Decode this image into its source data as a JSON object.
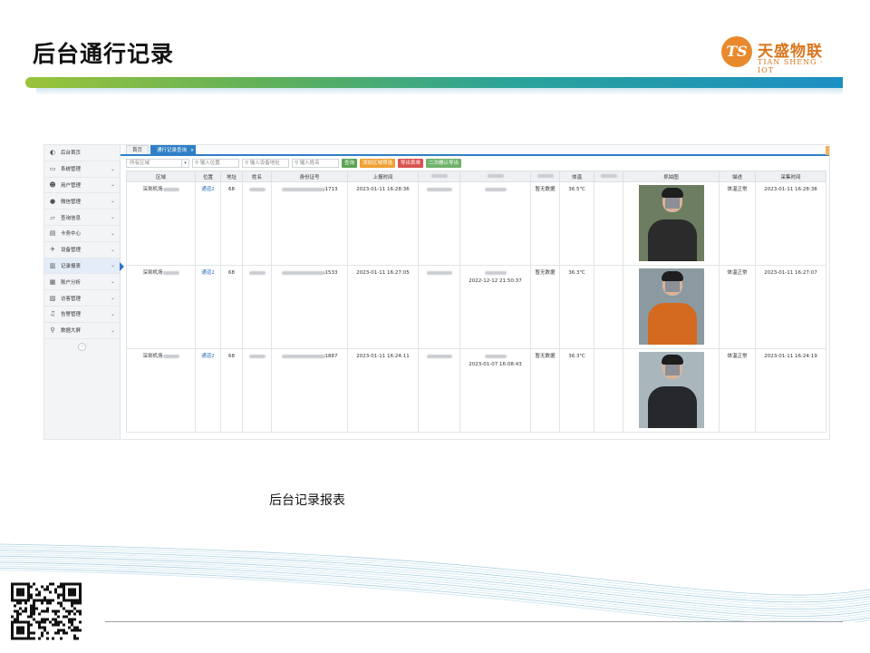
{
  "slide": {
    "title": "后台通行记录",
    "logo": {
      "mark": "TS",
      "mark_sub": "IOT",
      "name_cn": "天盛物联",
      "name_en": "TIAN SHENG · IOT"
    },
    "caption": "后台记录报表"
  },
  "app": {
    "sidebar": {
      "items": [
        {
          "label": "后台首页",
          "icon": "dashboard-icon",
          "active": false
        },
        {
          "label": "系统管理",
          "icon": "monitor-icon",
          "active": false
        },
        {
          "label": "用户管理",
          "icon": "users-icon",
          "active": false
        },
        {
          "label": "微信管理",
          "icon": "wechat-icon",
          "active": false
        },
        {
          "label": "查询信息",
          "icon": "laptop-icon",
          "active": false
        },
        {
          "label": "卡务中心",
          "icon": "card-icon",
          "active": false
        },
        {
          "label": "设备管理",
          "icon": "plane-icon",
          "active": false
        },
        {
          "label": "记录报表",
          "icon": "bar-chart-icon",
          "active": true
        },
        {
          "label": "账户分析",
          "icon": "calendar-icon",
          "active": false
        },
        {
          "label": "访客管理",
          "icon": "visitor-icon",
          "active": false
        },
        {
          "label": "告警管理",
          "icon": "bell-icon",
          "active": false
        },
        {
          "label": "数据大屏",
          "icon": "pin-icon",
          "active": false
        }
      ],
      "collapse_glyph": "‹"
    },
    "tabs": [
      {
        "label": "首页",
        "active": false
      },
      {
        "label": "通行记录查询",
        "active": true
      }
    ],
    "toolbar": {
      "area_select": "所有区域",
      "inputs": [
        "输入位置",
        "输入设备地址",
        "输入姓名"
      ],
      "buttons": [
        {
          "label": "查询",
          "color": "#5aa454"
        },
        {
          "label": "添加区域筛选",
          "color": "#f0a030"
        },
        {
          "label": "导出表单",
          "color": "#d9534f"
        },
        {
          "label": "二次确认导出",
          "color": "#6fb26a"
        }
      ]
    },
    "table": {
      "headers": [
        "区域",
        "位置",
        "地址",
        "姓名",
        "身份证号",
        "上报时间",
        "",
        "",
        "",
        "体温",
        "",
        "抓拍图",
        "描述",
        "采集时间"
      ],
      "rows": [
        {
          "area": "深圳机场",
          "location": "通道2",
          "address": "68",
          "id_tail": "1713",
          "report_time": "2023-01-11 16:28:36",
          "time2": "",
          "no_data": "暂无数据",
          "temperature": "36.5℃",
          "description": "体温正常",
          "collect_time": "2023-01-11 16:28:38",
          "photo_palette": {
            "bg": "#6d7d61",
            "body": "#2b2b2b"
          }
        },
        {
          "area": "深圳机场",
          "location": "通道2",
          "address": "68",
          "id_tail": "1533",
          "report_time": "2023-01-11 16:27:05",
          "time2": "2022-12-12 21:50:37",
          "no_data": "暂无数据",
          "temperature": "36.3℃",
          "description": "体温正常",
          "collect_time": "2023-01-11 16:27:07",
          "photo_palette": {
            "bg": "#8a9aa0",
            "body": "#d46a1f"
          }
        },
        {
          "area": "深圳机场",
          "location": "通道2",
          "address": "68",
          "id_tail": "1887",
          "report_time": "2023-01-11 16:24:11",
          "time2": "2023-01-07 16:08:43",
          "no_data": "暂无数据",
          "temperature": "36.3℃",
          "description": "体温正常",
          "collect_time": "2023-01-11 16:24:19",
          "photo_palette": {
            "bg": "#a9b7bd",
            "body": "#26282c"
          }
        }
      ]
    }
  },
  "colors": {
    "accent_blue": "#2f7fc6",
    "logo_orange": "#d9751c",
    "band_green": "#9bc33b",
    "band_blue": "#1c8fc4"
  }
}
